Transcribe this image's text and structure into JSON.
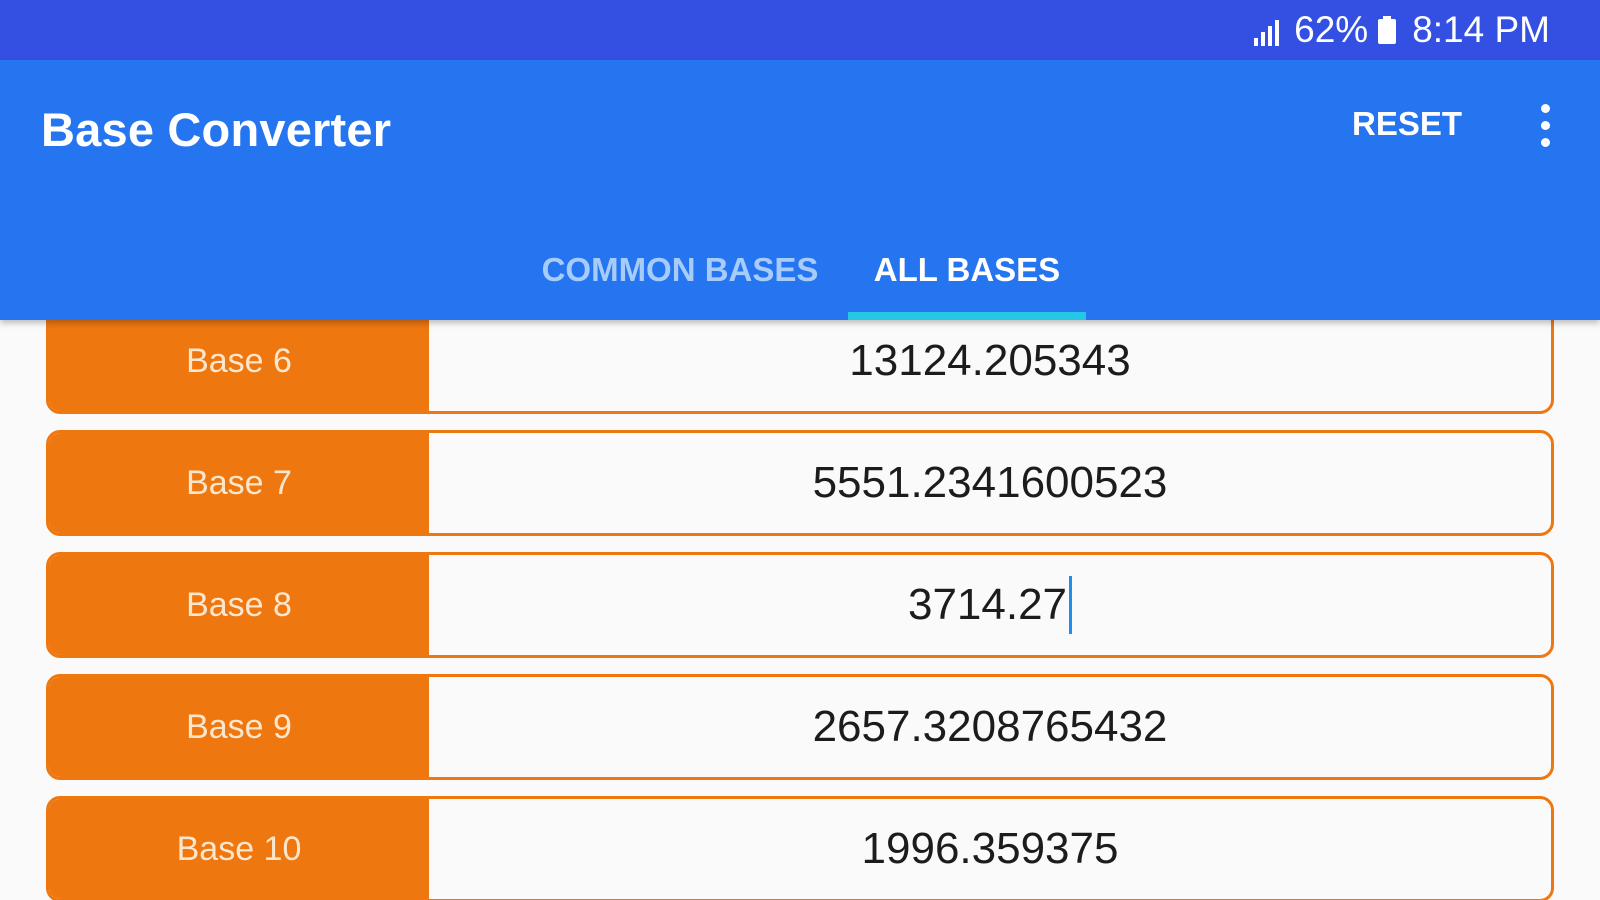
{
  "status_bar": {
    "battery_percent": "62%",
    "time": "8:14 PM",
    "signal_icon": "signal-icon",
    "battery_icon": "battery-icon"
  },
  "app_bar": {
    "title": "Base Converter",
    "reset_label": "RESET",
    "menu_icon": "more-vert-icon"
  },
  "tabs": [
    {
      "label": "COMMON BASES",
      "selected": false
    },
    {
      "label": "ALL BASES",
      "selected": true
    }
  ],
  "colors": {
    "status_bar": "#3350e3",
    "app_bar": "#2574f0",
    "tab_indicator": "#26c6e6",
    "accent_orange": "#ee7710"
  },
  "bases": [
    {
      "label": "Base 6",
      "value": "13124.205343"
    },
    {
      "label": "Base 7",
      "value": "5551.2341600523"
    },
    {
      "label": "Base 8",
      "value": "3714.27",
      "focused": true
    },
    {
      "label": "Base 9",
      "value": "2657.3208765432"
    },
    {
      "label": "Base 10",
      "value": "1996.359375"
    }
  ]
}
